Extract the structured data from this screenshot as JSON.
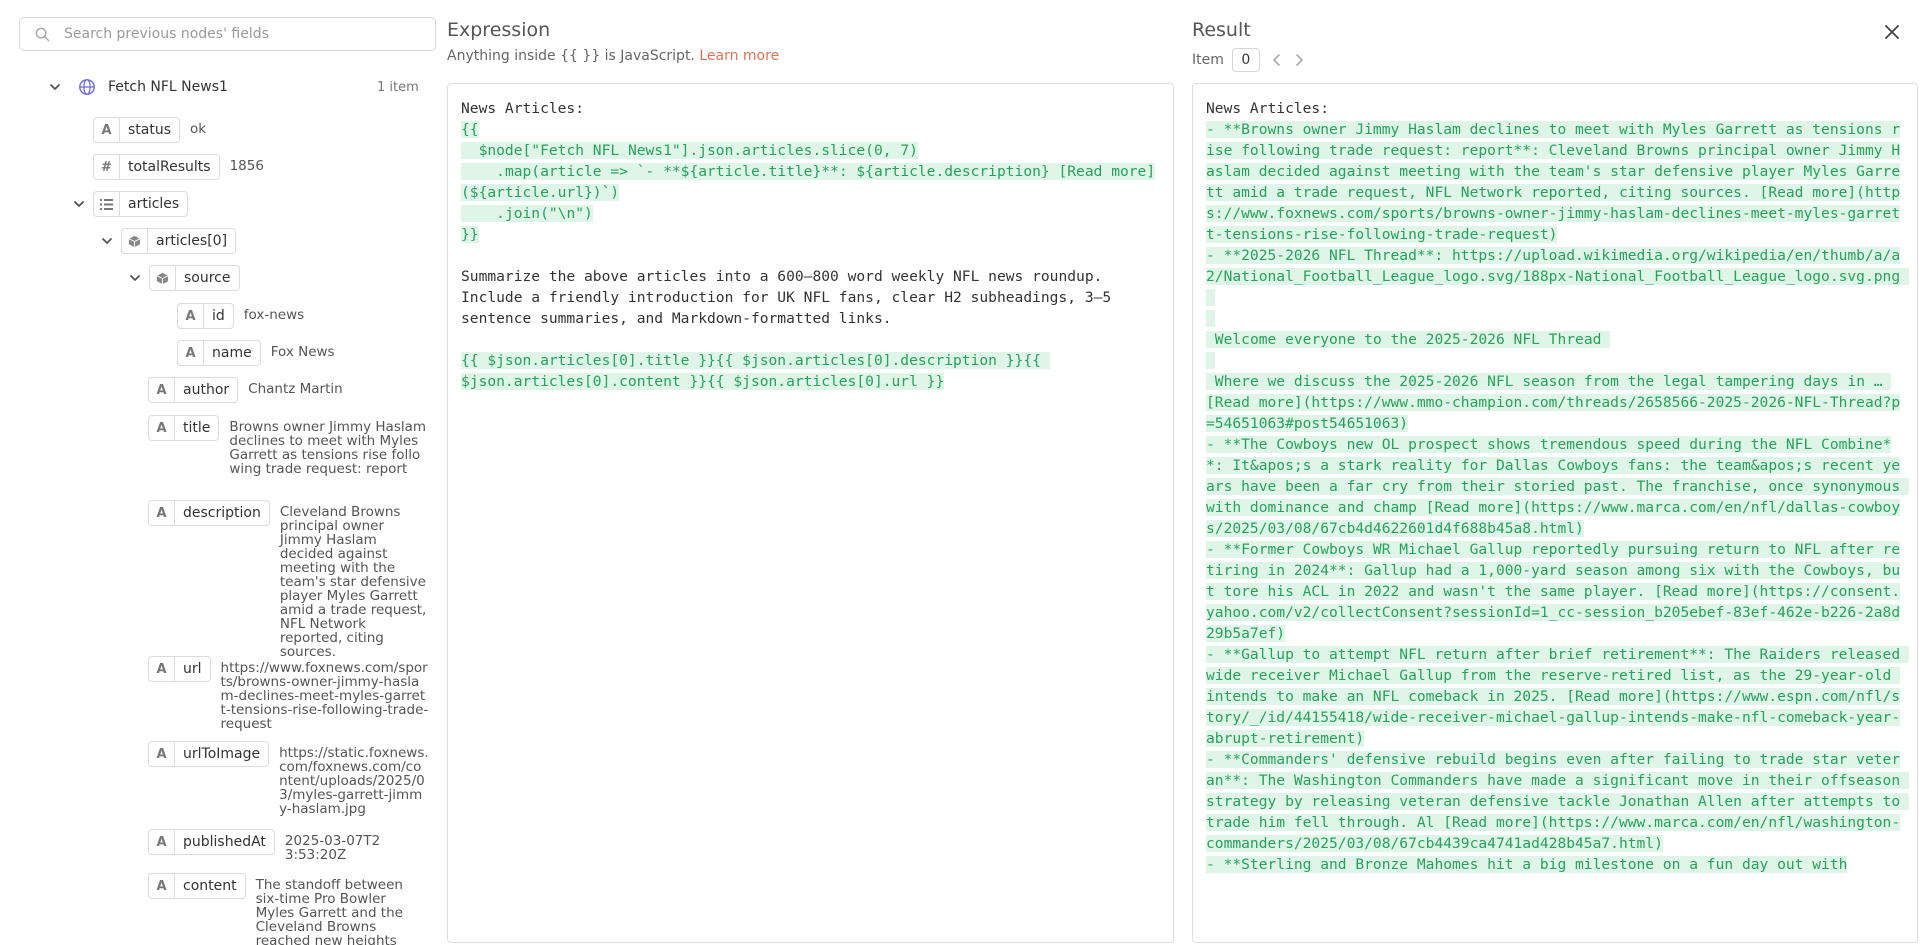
{
  "search": {
    "placeholder": "Search previous nodes' fields"
  },
  "tree": {
    "node": {
      "title": "Fetch NFL News1",
      "count": "1 item"
    },
    "status": {
      "key": "status",
      "value": "ok",
      "type": "A"
    },
    "totalResults": {
      "key": "totalResults",
      "value": "1856",
      "type": "#"
    },
    "articles": {
      "key": "articles"
    },
    "articles0": {
      "key": "articles[0]"
    },
    "source": {
      "key": "source"
    },
    "id": {
      "key": "id",
      "value": "fox-news",
      "type": "A"
    },
    "name": {
      "key": "name",
      "value": "Fox News",
      "type": "A"
    },
    "author": {
      "key": "author",
      "value": "Chantz Martin",
      "type": "A"
    },
    "title": {
      "key": "title",
      "value": "Browns owner Jimmy Haslam declines to meet with Myles Garrett as tensions rise following trade request: report",
      "type": "A"
    },
    "description": {
      "key": "description",
      "value": "Cleveland Browns principal owner Jimmy Haslam decided against meeting with the team's star defensive player Myles Garrett amid a trade request, NFL Network reported, citing sources.",
      "type": "A"
    },
    "url": {
      "key": "url",
      "value": "https://www.foxnews.com/sports/browns-owner-jimmy-haslam-declines-meet-myles-garrett-tensions-rise-following-trade-request",
      "type": "A"
    },
    "urlToImage": {
      "key": "urlToImage",
      "value": "https://static.foxnews.com/foxnews.com/content/uploads/2025/03/myles-garrett-jimmy-haslam.jpg",
      "type": "A"
    },
    "publishedAt": {
      "key": "publishedAt",
      "value": "2025-03-07T23:53:20Z",
      "type": "A"
    },
    "content": {
      "key": "content",
      "value": "The standoff between six-time Pro Bowler Myles Garrett and the Cleveland Browns reached new heights this week as",
      "type": "A"
    }
  },
  "expression": {
    "title": "Expression",
    "hint_prefix": "Anything inside {{ }} is JavaScript.",
    "hint_link": "Learn more",
    "line1": "News Articles:",
    "code": "{{\n  $node[\"Fetch NFL News1\"].json.articles.slice(0, 7)\n    .map(article => `- **${article.title}**: ${article.description} [Read more](${article.url})`)\n    .join(\"\\n\")\n}}",
    "paragraph": "Summarize the above articles into a 600–800 word weekly NFL news roundup. Include a friendly introduction for UK NFL fans, clear H2 subheadings, 3–5 sentence summaries, and Markdown-formatted links.",
    "code2": "{{ $json.articles[0].title }}{{ $json.articles[0].description }}{{ $json.articles[0].content }}{{ $json.articles[0].url }}"
  },
  "result": {
    "title": "Result",
    "item_label": "Item",
    "item_index": "0",
    "line1": "News Articles:",
    "body": "- **Browns owner Jimmy Haslam declines to meet with Myles Garrett as tensions rise following trade request: report**: Cleveland Browns principal owner Jimmy Haslam decided against meeting with the team's star defensive player Myles Garrett amid a trade request, NFL Network reported, citing sources. [Read more](https://www.foxnews.com/sports/browns-owner-jimmy-haslam-declines-meet-myles-garrett-tensions-rise-following-trade-request)\n- **2025-2026 NFL Thread**: https://upload.wikimedia.org/wikipedia/en/thumb/a/a2/National_Football_League_logo.svg/188px-National_Football_League_logo.svg.png \n \n \n Welcome everyone to the 2025-2026 NFL Thread \n \n Where we discuss the 2025-2026 NFL season from the legal tampering days in … [Read more](https://www.mmo-champion.com/threads/2658566-2025-2026-NFL-Thread?p=54651063#post54651063)\n- **The Cowboys new OL prospect shows tremendous speed during the NFL Combine**: It&apos;s a stark reality for Dallas Cowboys fans: the team&apos;s recent years have been a far cry from their storied past. The franchise, once synonymous with dominance and champ [Read more](https://www.marca.com/en/nfl/dallas-cowboys/2025/03/08/67cb4d4622601d4f688b45a8.html)\n- **Former Cowboys WR Michael Gallup reportedly pursuing return to NFL after retiring in 2024**: Gallup had a 1,000-yard season among six with the Cowboys, but tore his ACL in 2022 and wasn't the same player. [Read more](https://consent.yahoo.com/v2/collectConsent?sessionId=1_cc-session_b205ebef-83ef-462e-b226-2a8d29b5a7ef)\n- **Gallup to attempt NFL return after brief retirement**: The Raiders released wide receiver Michael Gallup from the reserve-retired list, as the 29-year-old intends to make an NFL comeback in 2025. [Read more](https://www.espn.com/nfl/story/_/id/44155418/wide-receiver-michael-gallup-intends-make-nfl-comeback-year-abrupt-retirement)\n- **Commanders' defensive rebuild begins even after failing to trade star veteran**: The Washington Commanders have made a significant move in their offseason strategy by releasing veteran defensive tackle Jonathan Allen after attempts to trade him fell through. Al [Read more](https://www.marca.com/en/nfl/washington-commanders/2025/03/08/67cb4439ca4741ad428b45a7.html)\n- **Sterling and Bronze Mahomes hit a big milestone on a fun day out with"
  }
}
